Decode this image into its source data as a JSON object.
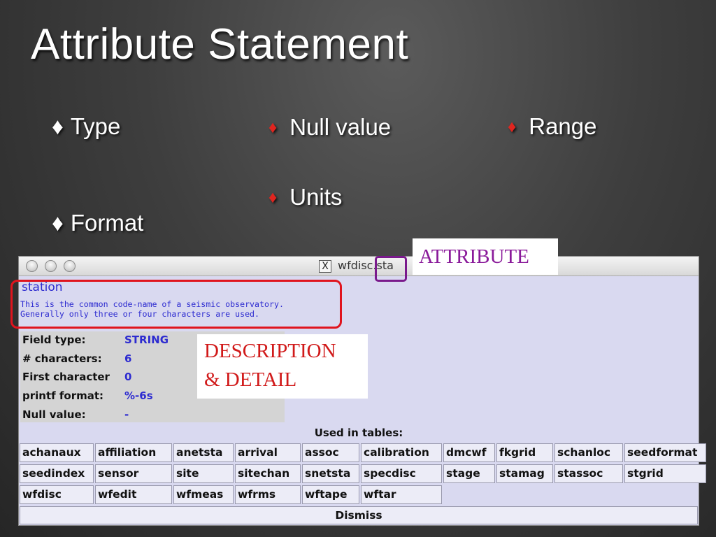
{
  "slide": {
    "title": "Attribute Statement",
    "bullets": {
      "type": "Type",
      "format": "Format",
      "null_value": "Null value",
      "units": "Units",
      "range": "Range"
    },
    "bullet_symbol": "♦"
  },
  "window": {
    "title": "wfdisc.sta",
    "x_logo": "X",
    "attribute": "station",
    "description_line1": "This is the common code-name of a seismic observatory.",
    "description_line2": "Generally only three or four characters are used.",
    "fields": [
      {
        "label": "Field type:",
        "value": "STRING"
      },
      {
        "label": "# characters:",
        "value": "6"
      },
      {
        "label": "First character",
        "value": "0"
      },
      {
        "label": "printf format:",
        "value": "%-6s"
      },
      {
        "label": "Null value:",
        "value": "-"
      }
    ],
    "used_in_tables_label": "Used in tables:",
    "tables": [
      "achanaux",
      "affiliation",
      "anetsta",
      "arrival",
      "assoc",
      "calibration",
      "dmcwf",
      "fkgrid",
      "schanloc",
      "seedformat",
      "seedindex",
      "sensor",
      "site",
      "sitechan",
      "snetsta",
      "specdisc",
      "stage",
      "stamag",
      "stassoc",
      "stgrid",
      "wfdisc",
      "wfedit",
      "wfmeas",
      "wfrms",
      "wftape",
      "wftar"
    ],
    "dismiss_label": "Dismiss"
  },
  "callouts": {
    "attribute": "ATTRIBUTE",
    "description_line1": "DESCRIPTION",
    "description_line2": "& DETAIL"
  },
  "colors": {
    "highlight_red": "#e0141e",
    "highlight_purple": "#7a1a8c",
    "value_blue": "#2d2bd0",
    "callout_purple": "#8a1a9a",
    "callout_red": "#d11a1a"
  }
}
